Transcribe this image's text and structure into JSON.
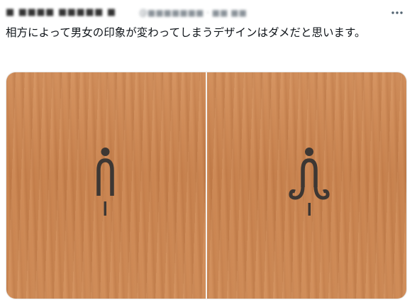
{
  "tweet": {
    "author_name": "■ ■■■■ ■■■■■ ■",
    "author_handle": "@■■■■■■■ · ■■ ■■",
    "more_icon": "more-horizontal-icon",
    "text": "相方によって男女の印象が変わってしまうデザインはダメだと思います。"
  },
  "media": {
    "left_icon": "restroom-sign-a-icon",
    "right_icon": "restroom-sign-b-icon",
    "wood_color": "#cd8954",
    "icon_color": "#3d3733"
  }
}
